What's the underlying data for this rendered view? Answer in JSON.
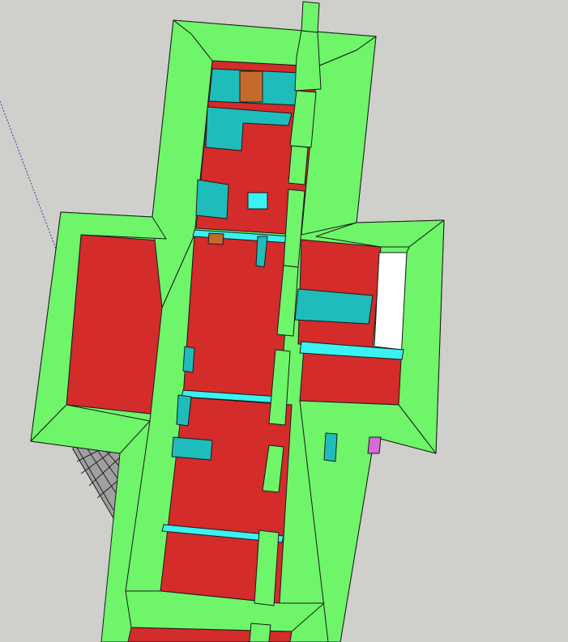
{
  "app": {
    "name": ""
  },
  "viewport": {
    "background_color": "#cfcfcb",
    "axis_color": "#3a3aa8"
  },
  "model": {
    "colors": {
      "exterior_wall": "#6ef56a",
      "floor": "#d42b2b",
      "interior_wall": "#1fbcbc",
      "wall_top": "#3af2f2",
      "wood_accent": "#c46a2c",
      "edge": "#1a1a1a",
      "window_light": "#ffffff",
      "lattice": "#a0a0a0"
    }
  }
}
